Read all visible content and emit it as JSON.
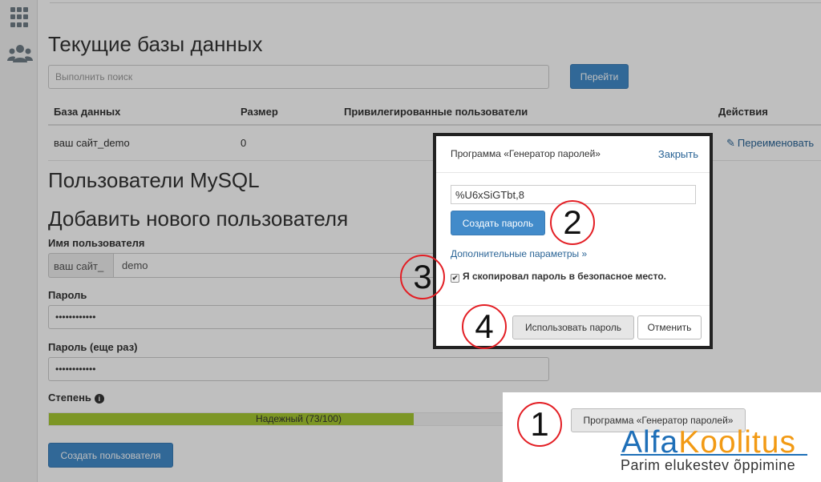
{
  "main": {
    "title": "Текущие базы данных",
    "search_placeholder": "Выполнить поиск",
    "go_label": "Перейти",
    "table": {
      "headers": [
        "База данных",
        "Размер",
        "Привилегированные пользователи",
        "Действия"
      ],
      "rows": [
        {
          "database": "ваш сайт_demo",
          "size": "0",
          "rename_label": "Переименовать"
        }
      ]
    },
    "mysql_users_heading": "Пользователи MySQL",
    "add_user_heading": "Добавить нового пользователя",
    "username_label": "Имя пользователя",
    "username_prefix": "ваш сайт_",
    "username_value": "demo",
    "password_label": "Пароль",
    "password_value": "••••••••••••",
    "password_again_label": "Пароль (еще раз)",
    "password_again_value": "••••••••••••",
    "strength_label": "Степень",
    "strength_text": "Надежный (73/100)",
    "strength_score": 73,
    "create_user_label": "Создать пользователя",
    "generator_button_label": "Программа «Генератор паролей»"
  },
  "modal": {
    "title": "Программа «Генератор паролей»",
    "close_label": "Закрыть",
    "generated_password": "%U6xSiGTbt,8",
    "create_password_label": "Создать пароль",
    "advanced_label": "Дополнительные параметры »",
    "copied_checkbox_label": "Я скопировал пароль в безопасное место.",
    "copied_checked": true,
    "use_password_label": "Использовать пароль",
    "cancel_label": "Отменить"
  },
  "callouts": [
    "1",
    "2",
    "3",
    "4"
  ],
  "brand": {
    "name_part1": "Alfa",
    "name_part2": "Koolitus",
    "tagline": "Parim elukestev õppimine",
    "primary_color": "#1e6fb8",
    "accent_color": "#f29a14"
  },
  "colors": {
    "primary_button": "#428bca",
    "strength_bar": "#a6c832",
    "callout_ring": "#e31e24"
  }
}
